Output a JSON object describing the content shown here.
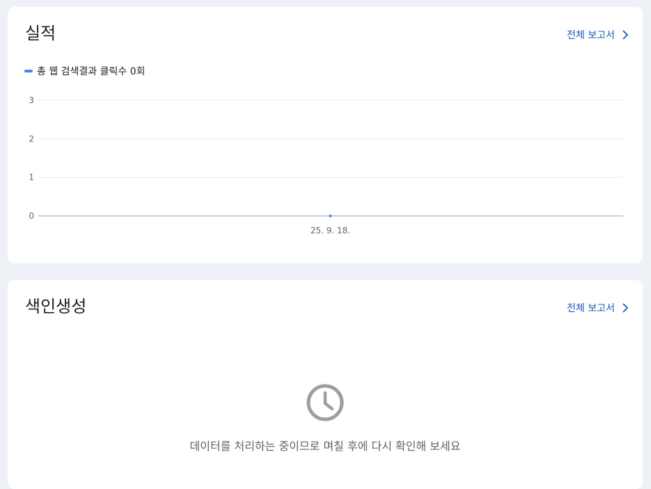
{
  "performance": {
    "title": "실적",
    "full_report_label": "전체 보고서",
    "legend": {
      "label": "총 웹 검색결과 클릭수 0회",
      "color": "#4285f4"
    }
  },
  "chart_data": {
    "type": "line",
    "x": [
      "25. 9. 18."
    ],
    "series": [
      {
        "name": "총 웹 검색결과 클릭수 0회",
        "values": [
          0
        ],
        "color": "#4285f4"
      }
    ],
    "ylim": [
      0,
      3
    ],
    "yticks": [
      "3",
      "2",
      "1",
      "0"
    ],
    "xticks": [
      "25. 9. 18."
    ],
    "grid": true
  },
  "indexing": {
    "title": "색인생성",
    "full_report_label": "전체 보고서",
    "icon": "clock-icon",
    "message": "데이터를 처리하는 중이므로 며칠 후에 다시 확인해 보세요"
  },
  "colors": {
    "accent": "#1a5ab8",
    "background": "#eef2f7",
    "card": "#ffffff"
  }
}
